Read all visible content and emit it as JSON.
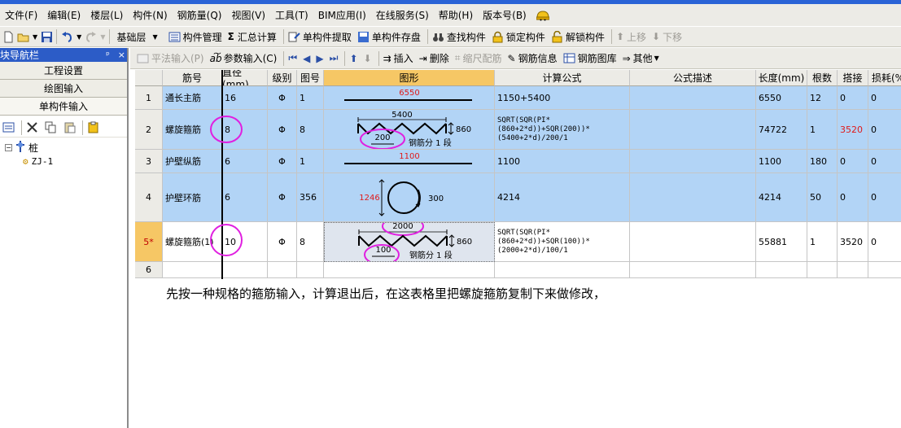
{
  "menu": [
    "文件(F)",
    "编辑(E)",
    "楼层(L)",
    "构件(N)",
    "钢筋量(Q)",
    "视图(V)",
    "工具(T)",
    "BIM应用(I)",
    "在线服务(S)",
    "帮助(H)",
    "版本号(B)"
  ],
  "toolbar1": {
    "layer": "基础层",
    "component_manage": "构件管理",
    "sum_calc": "汇总计算",
    "single_extract": "单构件提取",
    "single_save": "单构件存盘",
    "find": "查找构件",
    "lock": "锁定构件",
    "unlock": "解锁构件",
    "up": "上移",
    "down": "下移"
  },
  "sidebar": {
    "title": "模块导航栏",
    "pin": "ᵖ",
    "close": "×",
    "tabs": [
      "工程设置",
      "绘图输入",
      "单构件输入"
    ],
    "tree_root": "桩",
    "tree_leaf": "ZJ-1"
  },
  "toolbar2": {
    "flat_input": "平法输入(P)",
    "param_input": "参数输入(C)",
    "insert": "插入",
    "delete": "删除",
    "scale": "缩尺配筋",
    "rebar_info": "钢筋信息",
    "rebar_lib": "钢筋图库",
    "other": "其他"
  },
  "grid": {
    "headers": [
      "筋号",
      "直径(mm)",
      "级别",
      "图号",
      "图形",
      "计算公式",
      "公式描述",
      "长度(mm)",
      "根数",
      "搭接",
      "损耗(%)"
    ],
    "rows": [
      {
        "num": "1",
        "name": "通长主筋",
        "dia": "16",
        "grade": "Φ",
        "fig": "1",
        "formula": "1150+5400",
        "desc": "",
        "len": "6550",
        "count": "12",
        "lap": "0",
        "loss": "0",
        "shape_value": "6550"
      },
      {
        "num": "2",
        "name": "螺旋箍筋",
        "dia": "8",
        "grade": "Φ",
        "fig": "8",
        "formula": "SQRT(SQR(PI*(860+2*d))+SQR(200))*(5400+2*d)/200/1",
        "desc": "",
        "len": "74722",
        "count": "1",
        "lap": "3520",
        "loss": "0",
        "shape_length": "5400",
        "shape_height": "860",
        "shape_pitch": "200",
        "shape_note": "钢筋分 1 段"
      },
      {
        "num": "3",
        "name": "护壁纵筋",
        "dia": "6",
        "grade": "Φ",
        "fig": "1",
        "formula": "1100",
        "desc": "",
        "len": "1100",
        "count": "180",
        "lap": "0",
        "loss": "0",
        "shape_value": "1100"
      },
      {
        "num": "4",
        "name": "护壁环筋",
        "dia": "6",
        "grade": "Φ",
        "fig": "356",
        "formula": "4214",
        "desc": "",
        "len": "4214",
        "count": "50",
        "lap": "0",
        "loss": "0",
        "shape_height": "1246",
        "shape_value": "300"
      },
      {
        "num": "5*",
        "name": "螺旋箍筋(1)",
        "dia": "10",
        "grade": "Φ",
        "fig": "8",
        "formula": "SQRT(SQR(PI*(860+2*d))+SQR(100))*(2000+2*d)/100/1",
        "desc": "",
        "len": "55881",
        "count": "1",
        "lap": "3520",
        "loss": "0",
        "shape_length": "2000",
        "shape_height": "860",
        "shape_pitch": "100",
        "shape_note": "钢筋分 1 段"
      },
      {
        "num": "6"
      }
    ]
  },
  "note": "先按一种规格的箍筋输入，计算退出后，在这表格里把螺旋箍筋复制下来做修改，",
  "colors": {
    "selected_row": "#b2d4f6",
    "current_header": "#f6c765",
    "annotation": "#e020e0",
    "red_text": "#e01a1a"
  }
}
